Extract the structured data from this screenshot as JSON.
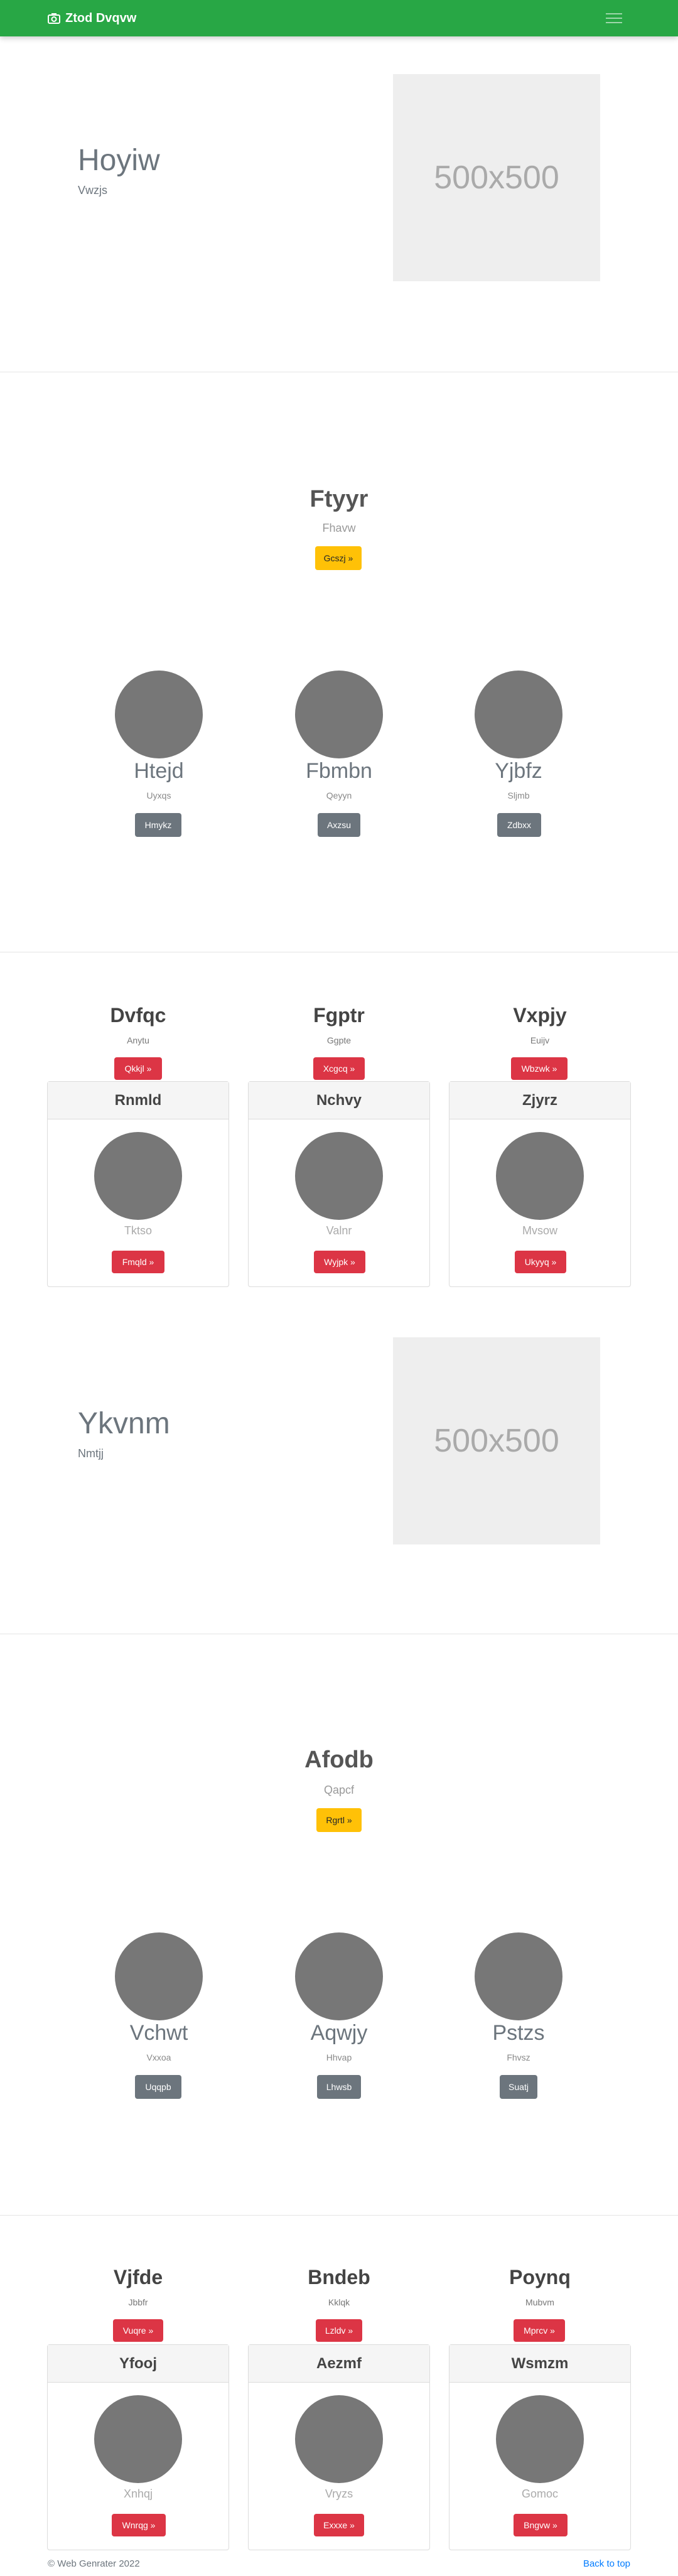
{
  "navbar": {
    "brand": "Ztod Dvqvw",
    "icon": "camera-icon",
    "toggler_icon": "hamburger-icon",
    "bg_color": "#28a745"
  },
  "hero1": {
    "title": "Hoyiw",
    "subtitle": "Vwzjs",
    "placeholder": "500x500"
  },
  "section1": {
    "title": "Ftyyr",
    "subtitle": "Fhavw",
    "button": "Gcszj »"
  },
  "team1": [
    {
      "name": "Htejd",
      "sub": "Uyxqs",
      "button": "Hmykz"
    },
    {
      "name": "Fbmbn",
      "sub": "Qeyyn",
      "button": "Axzsu"
    },
    {
      "name": "Yjbfz",
      "sub": "Sljmb",
      "button": "Zdbxx"
    }
  ],
  "cols1": [
    {
      "title": "Dvfqc",
      "sub": "Anytu",
      "button": "Qkkjl »"
    },
    {
      "title": "Fgptr",
      "sub": "Ggpte",
      "button": "Xcgcq »"
    },
    {
      "title": "Vxpjy",
      "sub": "Euijv",
      "button": "Wbzwk »"
    }
  ],
  "cards1": [
    {
      "header": "Rnmld",
      "sub": "Tktso",
      "button": "Fmqld »"
    },
    {
      "header": "Nchvy",
      "sub": "Valnr",
      "button": "Wyjpk »"
    },
    {
      "header": "Zjyrz",
      "sub": "Mvsow",
      "button": "Ukyyq »"
    }
  ],
  "hero2": {
    "title": "Ykvnm",
    "subtitle": "Nmtjj",
    "placeholder": "500x500"
  },
  "section2": {
    "title": "Afodb",
    "subtitle": "Qapcf",
    "button": "Rgrtl »"
  },
  "team2": [
    {
      "name": "Vchwt",
      "sub": "Vxxoa",
      "button": "Uqqpb"
    },
    {
      "name": "Aqwjy",
      "sub": "Hhvap",
      "button": "Lhwsb"
    },
    {
      "name": "Pstzs",
      "sub": "Fhvsz",
      "button": "Suatj"
    }
  ],
  "cols2": [
    {
      "title": "Vjfde",
      "sub": "Jbbfr",
      "button": "Vuqre »"
    },
    {
      "title": "Bndeb",
      "sub": "Kklqk",
      "button": "Lzldv »"
    },
    {
      "title": "Poynq",
      "sub": "Mubvm",
      "button": "Mprcv »"
    }
  ],
  "cards2": [
    {
      "header": "Yfooj",
      "sub": "Xnhqj",
      "button": "Wnrqg »"
    },
    {
      "header": "Aezmf",
      "sub": "Vryzs",
      "button": "Exxxe »"
    },
    {
      "header": "Wsmzm",
      "sub": "Gomoc",
      "button": "Bngvw »"
    }
  ],
  "footer": {
    "copyright": "© Web Genrater 2022",
    "back_to_top": "Back to top"
  }
}
